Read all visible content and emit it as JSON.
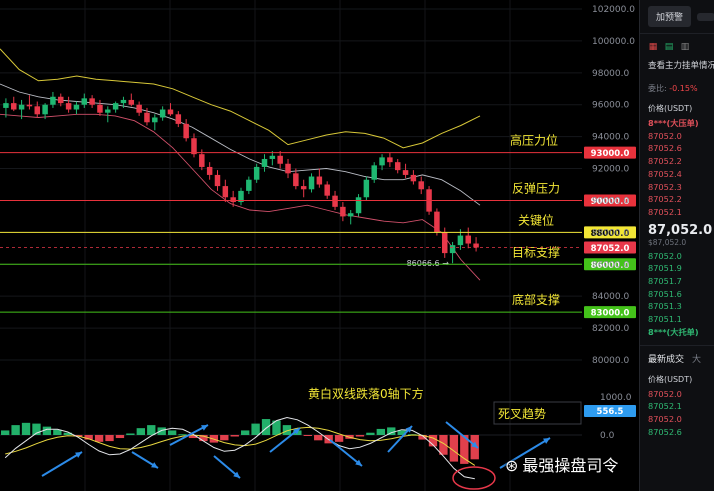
{
  "chart_data": {
    "type": "candlestick",
    "panels": [
      "price",
      "macd"
    ],
    "y_axis_ticks": [
      102000,
      100000,
      98000,
      96000,
      94000,
      92000,
      90000,
      88000,
      86000,
      84000,
      82000,
      80000
    ],
    "macd_axis_ticks": [
      1000,
      0
    ],
    "macd_value_label": "556.5",
    "current_price": 87052.0,
    "low_marker_label": "86066.6",
    "levels": [
      {
        "name": "高压力位",
        "price": 93000,
        "tag": "93000.0",
        "color": "#e8323c"
      },
      {
        "name": "反弹压力",
        "price": 90000,
        "tag": "90000.0",
        "color": "#e8323c"
      },
      {
        "name": "关键位",
        "price": 88000,
        "tag": "88000.0",
        "color": "#f2e636"
      },
      {
        "name": "目标支撑",
        "price": 86000,
        "tag": "86000.0",
        "color": "#44c21a"
      },
      {
        "name": "底部支撑",
        "price": 83000,
        "tag": "83000.0",
        "color": "#44c21a"
      }
    ],
    "current_tag": "87052.0",
    "annotations": [
      "黄白双线跌落0轴下方",
      "死叉趋势"
    ],
    "candles": [
      [
        95800,
        96400,
        95200,
        96100
      ],
      [
        96100,
        96500,
        95600,
        95700
      ],
      [
        95700,
        96300,
        95100,
        96000
      ],
      [
        96000,
        96600,
        95700,
        95900
      ],
      [
        95900,
        96200,
        95200,
        95400
      ],
      [
        95400,
        96100,
        95100,
        96000
      ],
      [
        96000,
        96800,
        95800,
        96500
      ],
      [
        96500,
        96700,
        95900,
        96100
      ],
      [
        96100,
        96500,
        95500,
        95700
      ],
      [
        95700,
        96200,
        95400,
        96000
      ],
      [
        96000,
        96700,
        95800,
        96400
      ],
      [
        96400,
        96600,
        95800,
        96000
      ],
      [
        96000,
        96300,
        95300,
        95500
      ],
      [
        95500,
        95900,
        94900,
        95700
      ],
      [
        95700,
        96200,
        95500,
        96100
      ],
      [
        96100,
        96500,
        95800,
        96300
      ],
      [
        96300,
        96700,
        95900,
        96000
      ],
      [
        96000,
        96200,
        95300,
        95500
      ],
      [
        95500,
        95800,
        94700,
        94900
      ],
      [
        94900,
        95400,
        94400,
        95200
      ],
      [
        95200,
        95900,
        95000,
        95700
      ],
      [
        95700,
        96100,
        95300,
        95400
      ],
      [
        95400,
        95600,
        94600,
        94800
      ],
      [
        94800,
        95100,
        93700,
        93900
      ],
      [
        93900,
        94200,
        92700,
        92900
      ],
      [
        92900,
        93200,
        91900,
        92100
      ],
      [
        92100,
        92400,
        91300,
        91600
      ],
      [
        91600,
        91900,
        90600,
        90900
      ],
      [
        90900,
        91300,
        89900,
        90200
      ],
      [
        90200,
        90600,
        89600,
        89900
      ],
      [
        89900,
        90800,
        89700,
        90600
      ],
      [
        90600,
        91500,
        90400,
        91300
      ],
      [
        91300,
        92300,
        91100,
        92100
      ],
      [
        92100,
        92900,
        91800,
        92600
      ],
      [
        92600,
        93100,
        92200,
        92800
      ],
      [
        92800,
        93100,
        92000,
        92300
      ],
      [
        92300,
        92600,
        91400,
        91700
      ],
      [
        91700,
        92000,
        90700,
        90900
      ],
      [
        90900,
        91300,
        90200,
        90700
      ],
      [
        90700,
        91700,
        90500,
        91500
      ],
      [
        91500,
        92000,
        90800,
        91000
      ],
      [
        91000,
        91200,
        90100,
        90300
      ],
      [
        90300,
        90600,
        89400,
        89600
      ],
      [
        89600,
        89900,
        88700,
        89000
      ],
      [
        89000,
        89400,
        88500,
        89200
      ],
      [
        89200,
        90400,
        89000,
        90200
      ],
      [
        90200,
        91500,
        90000,
        91300
      ],
      [
        91300,
        92400,
        91100,
        92200
      ],
      [
        92200,
        92900,
        91900,
        92700
      ],
      [
        92700,
        93000,
        92100,
        92400
      ],
      [
        92400,
        92600,
        91700,
        91900
      ],
      [
        91900,
        92300,
        91400,
        91600
      ],
      [
        91600,
        91900,
        91000,
        91200
      ],
      [
        91200,
        91500,
        90400,
        90700
      ],
      [
        90700,
        90900,
        89100,
        89300
      ],
      [
        89300,
        89500,
        87800,
        88000
      ],
      [
        88000,
        88300,
        86400,
        86700
      ],
      [
        86700,
        87400,
        86066,
        87200
      ],
      [
        87200,
        88200,
        86900,
        87800
      ],
      [
        87800,
        88300,
        87000,
        87300
      ],
      [
        87300,
        87700,
        86800,
        87052
      ]
    ],
    "bollinger": {
      "upper": [
        99500,
        98200,
        97500,
        97600,
        97800,
        97600,
        97500,
        97400,
        97300,
        97000,
        96500,
        96000,
        95600,
        95000,
        94400,
        93500,
        93800,
        94100,
        94300,
        94200,
        93900,
        93300,
        93600,
        94200,
        94700,
        95300
      ],
      "middle": [
        97300,
        96800,
        96500,
        96300,
        96200,
        96100,
        96000,
        95800,
        95500,
        95100,
        94600,
        93900,
        93200,
        92600,
        92100,
        91800,
        91900,
        92000,
        91800,
        91500,
        91300,
        91300,
        91600,
        91300,
        90600,
        89700
      ],
      "lower": [
        95400,
        95300,
        95200,
        95300,
        95400,
        95400,
        95300,
        95000,
        94300,
        93300,
        92000,
        90700,
        89800,
        89400,
        89300,
        89500,
        89700,
        89400,
        89100,
        88900,
        88700,
        88600,
        88800,
        88000,
        86300,
        85000
      ]
    },
    "macd": {
      "hist": [
        120,
        260,
        320,
        300,
        220,
        140,
        60,
        -40,
        -120,
        -180,
        -160,
        -80,
        40,
        180,
        260,
        200,
        120,
        20,
        -80,
        -160,
        -200,
        -140,
        -40,
        120,
        300,
        420,
        380,
        260,
        120,
        -20,
        -140,
        -220,
        -180,
        -100,
        -40,
        60,
        160,
        200,
        120,
        20,
        -120,
        -300,
        -520,
        -700,
        -760,
        -640
      ],
      "dif": [
        -600,
        -350,
        -150,
        50,
        150,
        150,
        80,
        -60,
        -250,
        -420,
        -520,
        -500,
        -380,
        -200,
        -20,
        120,
        180,
        150,
        20,
        -160,
        -330,
        -430,
        -400,
        -260,
        -60,
        180,
        380,
        460,
        400,
        260,
        80,
        -120,
        -280,
        -360,
        -320,
        -220,
        -80,
        60,
        140,
        120,
        -20,
        -260,
        -560,
        -880,
        -1100,
        -1150
      ],
      "dea": [
        -500,
        -430,
        -340,
        -230,
        -130,
        -60,
        -20,
        -30,
        -100,
        -200,
        -300,
        -360,
        -370,
        -330,
        -260,
        -170,
        -90,
        -30,
        0,
        -30,
        -110,
        -200,
        -260,
        -280,
        -240,
        -140,
        -10,
        110,
        180,
        200,
        180,
        120,
        30,
        -60,
        -120,
        -150,
        -140,
        -100,
        -40,
        0,
        -10,
        -80,
        -220,
        -420,
        -620,
        -800
      ]
    }
  },
  "side_panel": {
    "set_alert_button": "加预警",
    "alert_cut": "",
    "link_text": "查看主力挂单情况",
    "ratio_label": "委比:",
    "ratio_value": "-0.15%",
    "price_header": "价格(USDT)",
    "ask_big_order": "8***(大压单)",
    "asks": [
      "87052.0",
      "87052.6",
      "87052.2",
      "87052.4",
      "87052.3",
      "87052.2",
      "87052.1"
    ],
    "last_price": "87,052.0",
    "last_price_sub": "$87,052.0",
    "bids": [
      "87052.0",
      "87051.9",
      "87051.7",
      "87051.6",
      "87051.3",
      "87051.1"
    ],
    "bid_big_order": "8***(大托单)",
    "trades_tab": "最新成交",
    "trades_tab2": "大",
    "trades_price_header": "价格(USDT)",
    "trades": [
      "87052.0",
      "87052.1",
      "87052.0",
      "87052.6"
    ]
  },
  "watermark": "最强操盘司令"
}
